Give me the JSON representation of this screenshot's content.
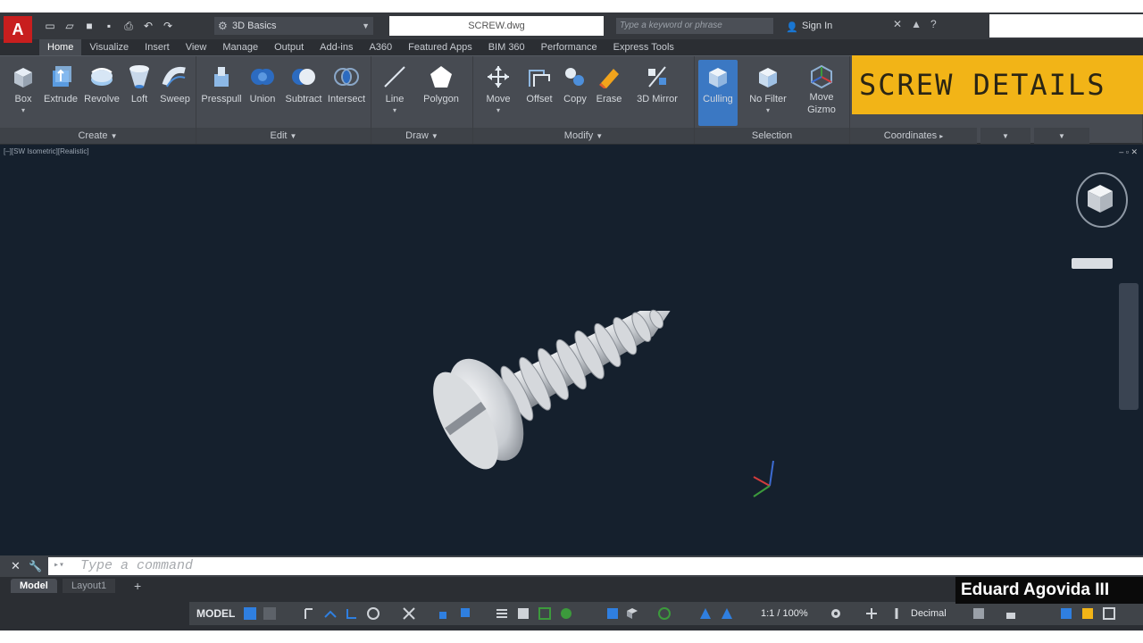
{
  "app": {
    "logo_letter": "A",
    "workspace": "3D Basics",
    "filename": "SCREW.dwg",
    "search_placeholder": "Type a keyword or phrase",
    "sign_in": "Sign In"
  },
  "tabs": [
    "Home",
    "Visualize",
    "Insert",
    "View",
    "Manage",
    "Output",
    "Add-ins",
    "A360",
    "Featured Apps",
    "BIM 360",
    "Performance",
    "Express Tools"
  ],
  "ribbon": {
    "create": {
      "title": "Create",
      "tools": [
        "Box",
        "Extrude",
        "Revolve",
        "Loft",
        "Sweep"
      ]
    },
    "edit": {
      "title": "Edit",
      "tools": [
        "Presspull",
        "Union",
        "Subtract",
        "Intersect"
      ]
    },
    "draw": {
      "title": "Draw",
      "tools": [
        "Line",
        "Polygon"
      ]
    },
    "modify": {
      "title": "Modify",
      "tools": [
        "Move",
        "Offset",
        "Copy",
        "Erase",
        "3D Mirror"
      ]
    },
    "selection": {
      "title": "Selection",
      "tools": [
        "Culling",
        "No Filter",
        "Move",
        "Gizmo"
      ]
    },
    "coordinates": {
      "title": "Coordinates"
    }
  },
  "banner": "SCREW DETAILS",
  "viewport": {
    "label": "[–][SW Isometric][Realistic]"
  },
  "command": {
    "placeholder": "Type a command"
  },
  "layout_tabs": [
    "Model",
    "Layout1",
    "+"
  ],
  "status": {
    "model": "MODEL",
    "scale": "1:1 / 100%",
    "units": "Decimal"
  },
  "author": "Eduard Agovida III",
  "colors": {
    "accent": "#3b78c3",
    "logo": "#c81e1e",
    "banner": "#f2b417",
    "viewport_bg": "#15202d"
  }
}
